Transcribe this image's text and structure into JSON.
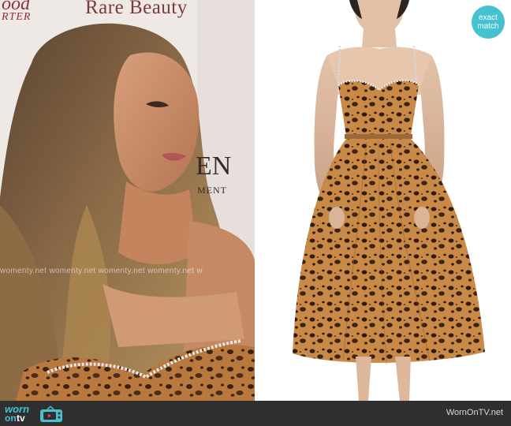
{
  "left_photo": {
    "backdrop": {
      "brand": "Rare Beauty",
      "logo_line1": "ood",
      "logo_line2": "RTER",
      "partial_word": "EN",
      "partial_line": "MENT"
    },
    "watermark": "womenty.net  womenty.net  womenty.net  womenty.net  w"
  },
  "badge": {
    "line1": "exact",
    "line2": "match",
    "color": "#45c1cf"
  },
  "footer": {
    "logo_top": "worn",
    "logo_on": "on",
    "logo_tv": "tv",
    "site": "WornOnTV.net",
    "accent": "#45c1cf"
  }
}
